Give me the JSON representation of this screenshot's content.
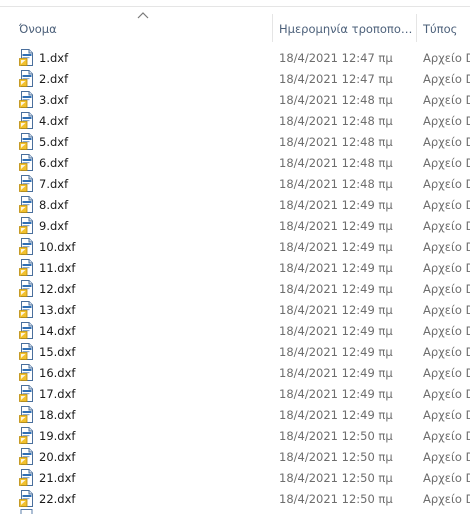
{
  "header": {
    "name_label": "Όνομα",
    "date_label": "Ημερομηνία τροποποί...",
    "type_label": "Τύπος"
  },
  "icons": {
    "file_icon": "dxf-file-icon",
    "sort": "sort-ascending-icon"
  },
  "colors": {
    "header_text": "#4c607a",
    "secondary_text": "#6d6d6d"
  },
  "files": [
    {
      "name": "1.dxf",
      "date": "18/4/2021 12:47 πμ",
      "type": "Αρχείο D"
    },
    {
      "name": "2.dxf",
      "date": "18/4/2021 12:47 πμ",
      "type": "Αρχείο D"
    },
    {
      "name": "3.dxf",
      "date": "18/4/2021 12:48 πμ",
      "type": "Αρχείο D"
    },
    {
      "name": "4.dxf",
      "date": "18/4/2021 12:48 πμ",
      "type": "Αρχείο D"
    },
    {
      "name": "5.dxf",
      "date": "18/4/2021 12:48 πμ",
      "type": "Αρχείο D"
    },
    {
      "name": "6.dxf",
      "date": "18/4/2021 12:48 πμ",
      "type": "Αρχείο D"
    },
    {
      "name": "7.dxf",
      "date": "18/4/2021 12:48 πμ",
      "type": "Αρχείο D"
    },
    {
      "name": "8.dxf",
      "date": "18/4/2021 12:49 πμ",
      "type": "Αρχείο D"
    },
    {
      "name": "9.dxf",
      "date": "18/4/2021 12:49 πμ",
      "type": "Αρχείο D"
    },
    {
      "name": "10.dxf",
      "date": "18/4/2021 12:49 πμ",
      "type": "Αρχείο D"
    },
    {
      "name": "11.dxf",
      "date": "18/4/2021 12:49 πμ",
      "type": "Αρχείο D"
    },
    {
      "name": "12.dxf",
      "date": "18/4/2021 12:49 πμ",
      "type": "Αρχείο D"
    },
    {
      "name": "13.dxf",
      "date": "18/4/2021 12:49 πμ",
      "type": "Αρχείο D"
    },
    {
      "name": "14.dxf",
      "date": "18/4/2021 12:49 πμ",
      "type": "Αρχείο D"
    },
    {
      "name": "15.dxf",
      "date": "18/4/2021 12:49 πμ",
      "type": "Αρχείο D"
    },
    {
      "name": "16.dxf",
      "date": "18/4/2021 12:49 πμ",
      "type": "Αρχείο D"
    },
    {
      "name": "17.dxf",
      "date": "18/4/2021 12:49 πμ",
      "type": "Αρχείο D"
    },
    {
      "name": "18.dxf",
      "date": "18/4/2021 12:49 πμ",
      "type": "Αρχείο D"
    },
    {
      "name": "19.dxf",
      "date": "18/4/2021 12:50 πμ",
      "type": "Αρχείο D"
    },
    {
      "name": "20.dxf",
      "date": "18/4/2021 12:50 πμ",
      "type": "Αρχείο D"
    },
    {
      "name": "21.dxf",
      "date": "18/4/2021 12:50 πμ",
      "type": "Αρχείο D"
    },
    {
      "name": "22.dxf",
      "date": "18/4/2021 12:50 πμ",
      "type": "Αρχείο D"
    }
  ]
}
